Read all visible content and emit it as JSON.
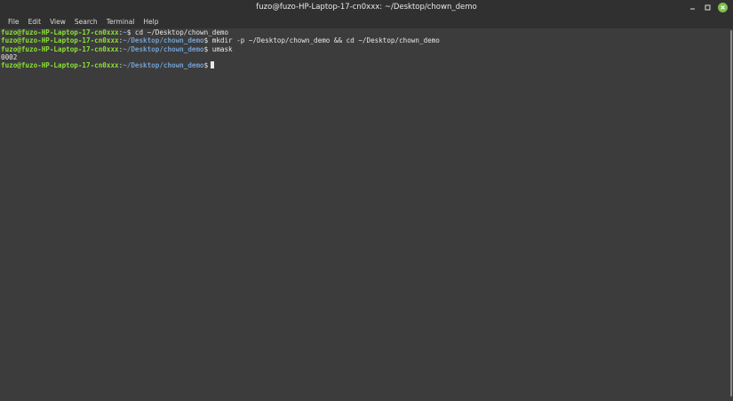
{
  "window": {
    "title": "fuzo@fuzo-HP-Laptop-17-cn0xxx: ~/Desktop/chown_demo"
  },
  "menu": {
    "items": [
      "File",
      "Edit",
      "View",
      "Search",
      "Terminal",
      "Help"
    ]
  },
  "terminal": {
    "lines": [
      {
        "user": "fuzo@fuzo-HP-Laptop-17-cn0xxx",
        "path": "~",
        "command": "cd ~/Desktop/chown_demo"
      },
      {
        "user": "fuzo@fuzo-HP-Laptop-17-cn0xxx",
        "path": "~/Desktop/chown_demo",
        "command": "mkdir -p ~/Desktop/chown_demo && cd ~/Desktop/chown_demo"
      },
      {
        "user": "fuzo@fuzo-HP-Laptop-17-cn0xxx",
        "path": "~/Desktop/chown_demo",
        "command": "umask"
      },
      {
        "output": "0002"
      },
      {
        "user": "fuzo@fuzo-HP-Laptop-17-cn0xxx",
        "path": "~/Desktop/chown_demo",
        "command": ""
      }
    ],
    "prompt_colon": ":",
    "prompt_dollar": "$"
  },
  "colors": {
    "user": "#8ae234",
    "path": "#729fcf",
    "background": "#3c3c3c",
    "close_button": "#7dbf4a"
  },
  "icons": {
    "minimize": "minimize-icon",
    "maximize": "maximize-icon",
    "close": "close-icon"
  }
}
